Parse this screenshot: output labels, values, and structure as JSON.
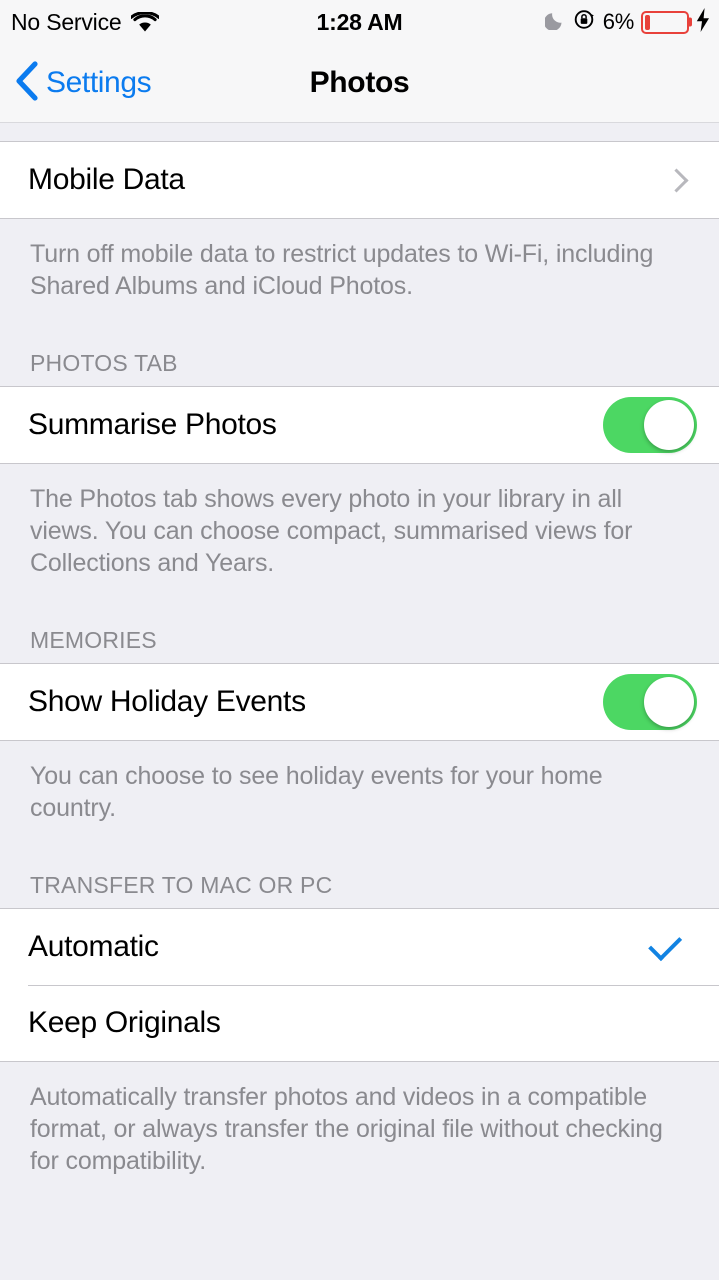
{
  "status_bar": {
    "carrier": "No Service",
    "wifi_icon": "wifi-icon",
    "time": "1:28 AM",
    "dnd_icon": "moon-icon",
    "rotation_lock_icon": "rotation-lock-icon",
    "battery_percent": "6%",
    "battery_level": 6,
    "charging_icon": "lightning-bolt-icon",
    "battery_color": "#E8413B"
  },
  "nav": {
    "back_icon": "chevron-left-icon",
    "back_label": "Settings",
    "title": "Photos",
    "accent_color": "#0B7BEF"
  },
  "sections": {
    "mobile_data": {
      "row_label": "Mobile Data",
      "disclosure_icon": "chevron-right-icon",
      "footer": "Turn off mobile data to restrict updates to Wi-Fi, including Shared Albums and iCloud Photos."
    },
    "photos_tab": {
      "header": "PHOTOS TAB",
      "row_label": "Summarise Photos",
      "toggle_on": true,
      "toggle_color": "#4CD763",
      "footer": "The Photos tab shows every photo in your library in all views. You can choose compact, summarised views for Collections and Years."
    },
    "memories": {
      "header": "MEMORIES",
      "row_label": "Show Holiday Events",
      "toggle_on": true,
      "toggle_color": "#4CD763",
      "footer": "You can choose to see holiday events for your home country."
    },
    "transfer": {
      "header": "TRANSFER TO MAC OR PC",
      "option_automatic": "Automatic",
      "option_keep_originals": "Keep Originals",
      "selected": "Automatic",
      "checkmark_icon": "checkmark-icon",
      "checkmark_color": "#1283E2",
      "footer": "Automatically transfer photos and videos in a compatible format, or always transfer the original file without checking for compatibility."
    }
  }
}
